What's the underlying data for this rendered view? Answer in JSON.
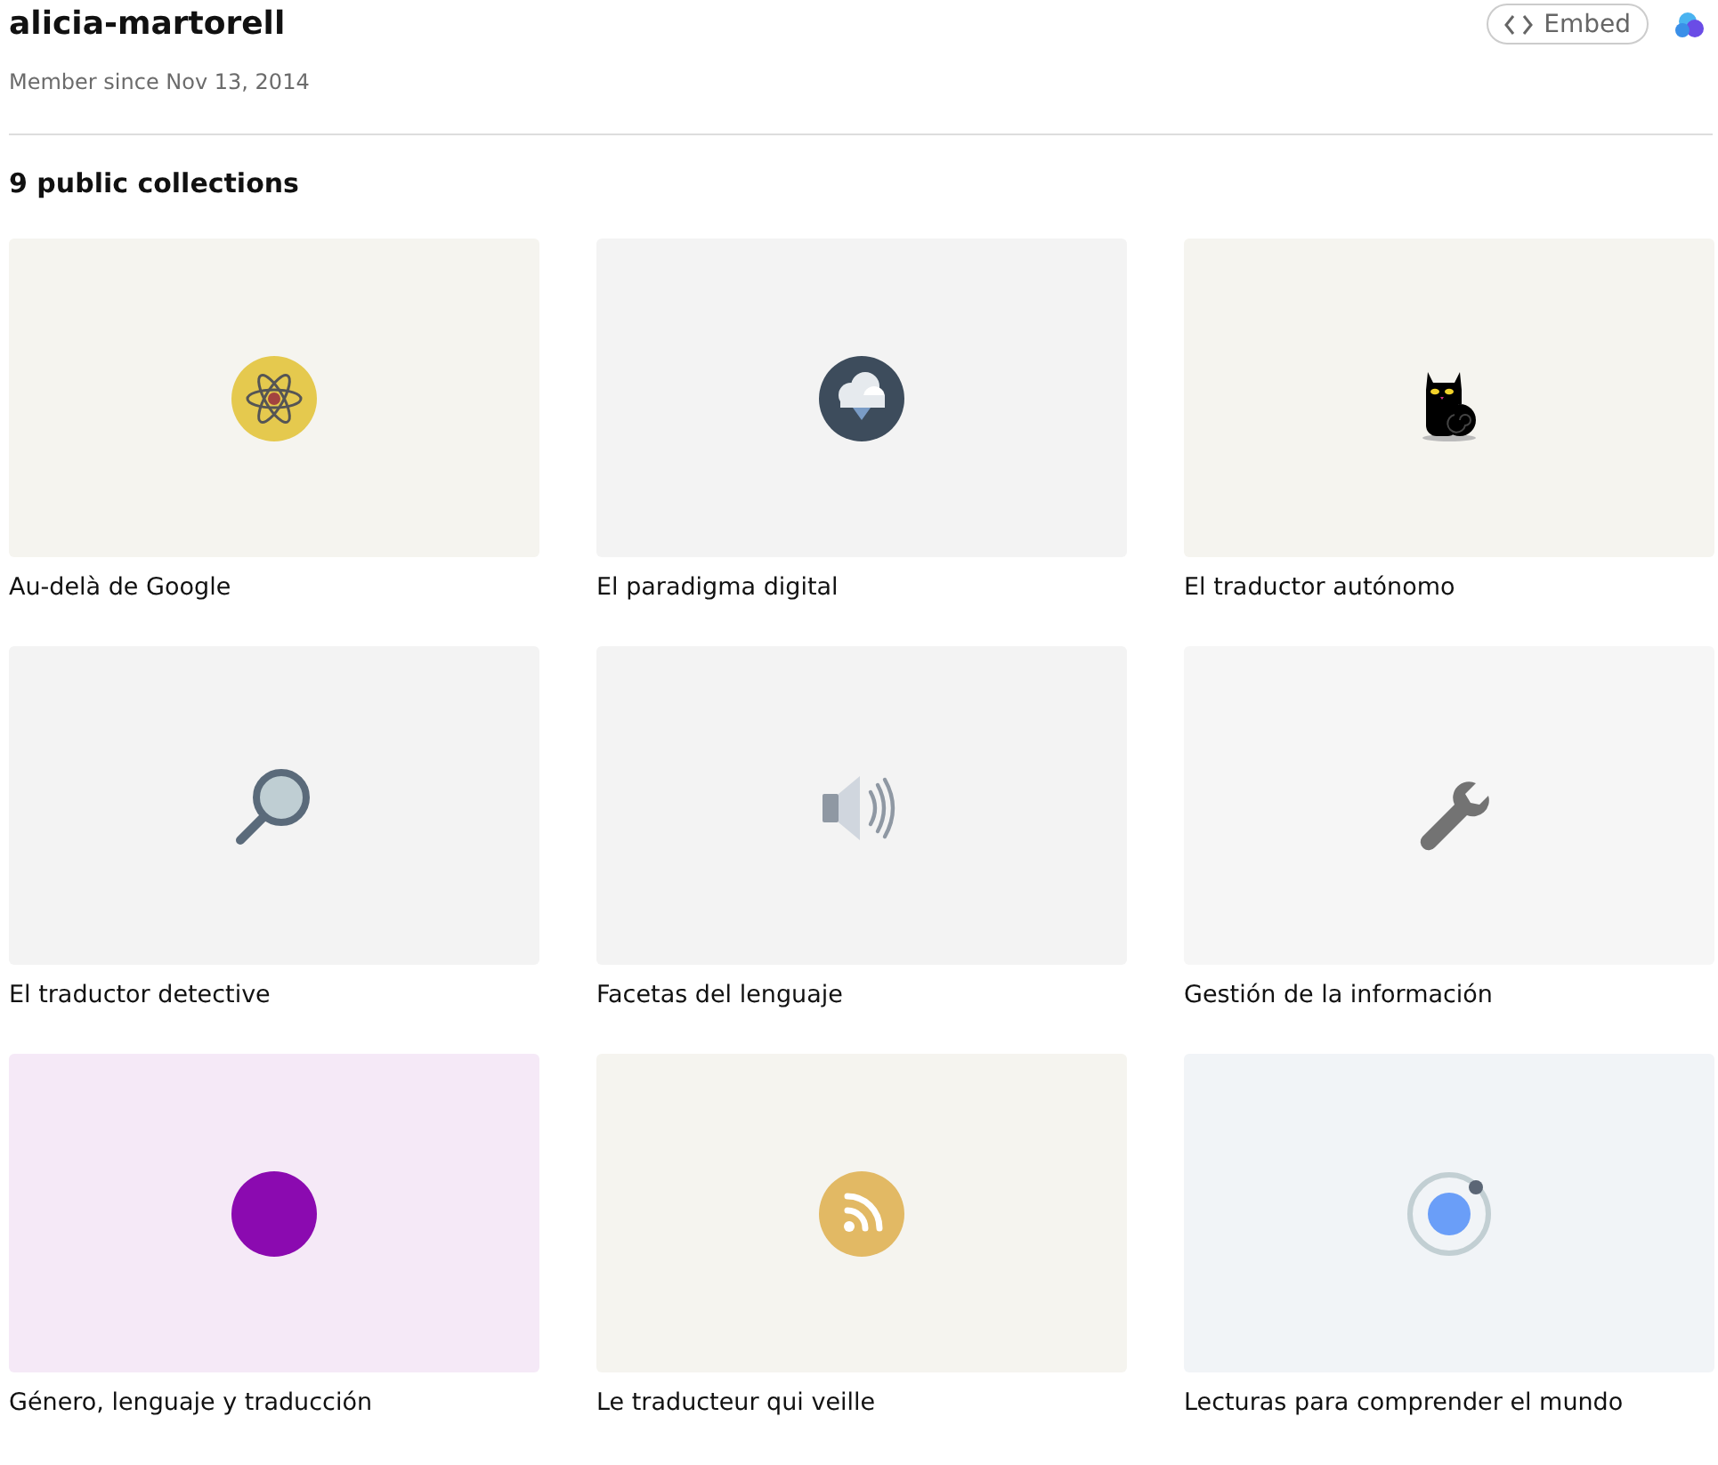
{
  "profile": {
    "username": "alicia-martorell",
    "member_since": "Member since Nov 13, 2014"
  },
  "embed_button": {
    "label": "Embed"
  },
  "collections_heading": "9 public collections",
  "collections": [
    {
      "title": "Au-delà de Google",
      "kind": "atom",
      "color": "#f5f4ef"
    },
    {
      "title": "El paradigma digital",
      "kind": "cloud",
      "color": "#f3f3f3"
    },
    {
      "title": "El traductor autónomo",
      "kind": "cat",
      "color": "#f5f4ef"
    },
    {
      "title": "El traductor detective",
      "kind": "magnifier",
      "color": "#f3f3f3"
    },
    {
      "title": "Facetas del lenguaje",
      "kind": "speaker",
      "color": "#f3f3f3"
    },
    {
      "title": "Gestión de la información",
      "kind": "wrench",
      "color": "#f6f6f6"
    },
    {
      "title": "Género, lenguaje y traducción",
      "kind": "dot",
      "color": "#f5e9f7"
    },
    {
      "title": "Le traducteur qui veille",
      "kind": "rss",
      "color": "#f5f4ef"
    },
    {
      "title": "Lecturas para comprender el mundo",
      "kind": "orbit",
      "color": "#f1f4f7"
    }
  ]
}
